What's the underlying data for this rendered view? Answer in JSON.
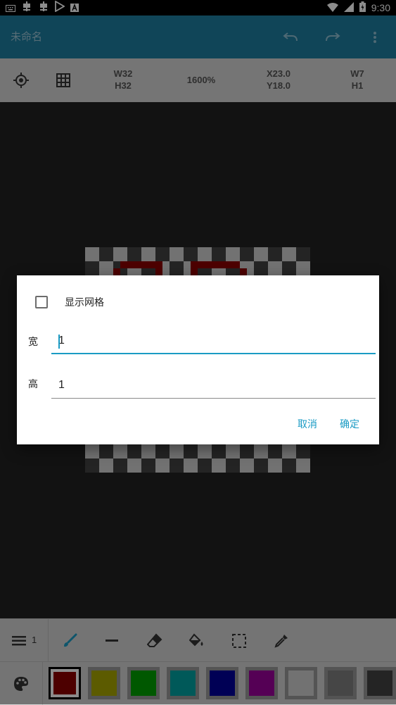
{
  "status_bar": {
    "time": "9:30",
    "left_icons": [
      "keyboard-icon",
      "bug-icon",
      "bug-icon",
      "play-store-icon",
      "font-icon"
    ],
    "right_icons": [
      "wifi-icon",
      "signal-icon",
      "battery-icon"
    ]
  },
  "app_bar": {
    "title": "未命名",
    "actions": [
      "undo-icon",
      "redo-icon",
      "more-vert-icon"
    ]
  },
  "info_bar": {
    "canvas_w": "W32",
    "canvas_h": "H32",
    "zoom": "1600%",
    "cursor_x": "X23.0",
    "cursor_y": "Y18.0",
    "sel_w": "W7",
    "sel_h": "H1"
  },
  "dialog": {
    "show_grid_label": "显示网格",
    "show_grid_checked": false,
    "width_label": "宽",
    "width_value": "1",
    "height_label": "高",
    "height_value": "1",
    "cancel_label": "取消",
    "ok_label": "确定"
  },
  "tools": {
    "layer_count": "1",
    "items": [
      "layers-icon",
      "brush-icon",
      "line-icon",
      "eraser-icon",
      "fill-bucket-icon",
      "selection-icon",
      "eyedropper-icon"
    ]
  },
  "palette": {
    "colors": [
      "#8c0000",
      "#a8a600",
      "#00a000",
      "#00a3a3",
      "#00009c",
      "#9c009c",
      "#cfcfcf",
      "#808080",
      "#424242"
    ],
    "selected_index": 0
  },
  "accent": "#1a9bc4",
  "app_bar_color": "#1e7ea1"
}
